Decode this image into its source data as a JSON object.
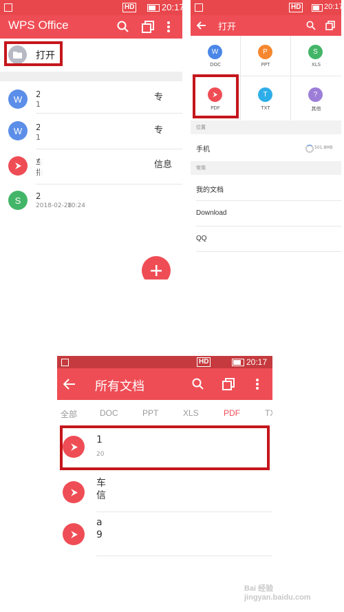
{
  "panel1": {
    "status": {
      "time": "20:17",
      "hd": "HD"
    },
    "title": "WPS Office",
    "open_label": "打开",
    "files": [
      {
        "letter": "W",
        "type": "doc",
        "frag1": "2",
        "frag2": "1",
        "right": "专"
      },
      {
        "letter": "W",
        "type": "doc",
        "frag1": "2",
        "frag2": "1",
        "right": "专"
      },
      {
        "letter": "",
        "type": "pdf",
        "frag1": "车",
        "frag2": "指",
        "right": "信息"
      },
      {
        "letter": "S",
        "type": "xls",
        "frag1": "2",
        "frag2": "",
        "right": ""
      }
    ],
    "last_date": "2018-02-28",
    "last_time": "10:24"
  },
  "panel2": {
    "status": {
      "time": "20:17",
      "hd": "HD"
    },
    "title": "打开",
    "types": [
      {
        "letter": "W",
        "label": "DOC",
        "color": "#4a86e8"
      },
      {
        "letter": "P",
        "label": "PPT",
        "color": "#f7872e"
      },
      {
        "letter": "S",
        "label": "XLS",
        "color": "#43b568"
      },
      {
        "letter": "",
        "label": "PDF",
        "color": "#ef4d55"
      },
      {
        "letter": "T",
        "label": "TXT",
        "color": "#2eaee8"
      },
      {
        "letter": "?",
        "label": "其他",
        "color": "#9c7ed8"
      }
    ],
    "section_location": "位置",
    "phone_label": "手机",
    "phone_size": "501.8MB",
    "section_common": "常用",
    "common_items": [
      "我的文档",
      "Download",
      "QQ"
    ]
  },
  "panel3": {
    "status": {
      "time": "20:17",
      "hd": "HD"
    },
    "title": "所有文档",
    "tabs": [
      "全部",
      "DOC",
      "PPT",
      "XLS",
      "PDF",
      "TX"
    ],
    "active_tab": "PDF",
    "files": [
      {
        "frag1": "1",
        "frag2": "20"
      },
      {
        "frag1": "车",
        "frag2": "信"
      },
      {
        "frag1": "a",
        "frag2": "9"
      }
    ]
  },
  "colors": {
    "brand": "#ef4d55",
    "status_bar": "#e8474c",
    "highlight": "#c4161c"
  },
  "watermark": "Bai 经验 jingyan.baidu.com"
}
